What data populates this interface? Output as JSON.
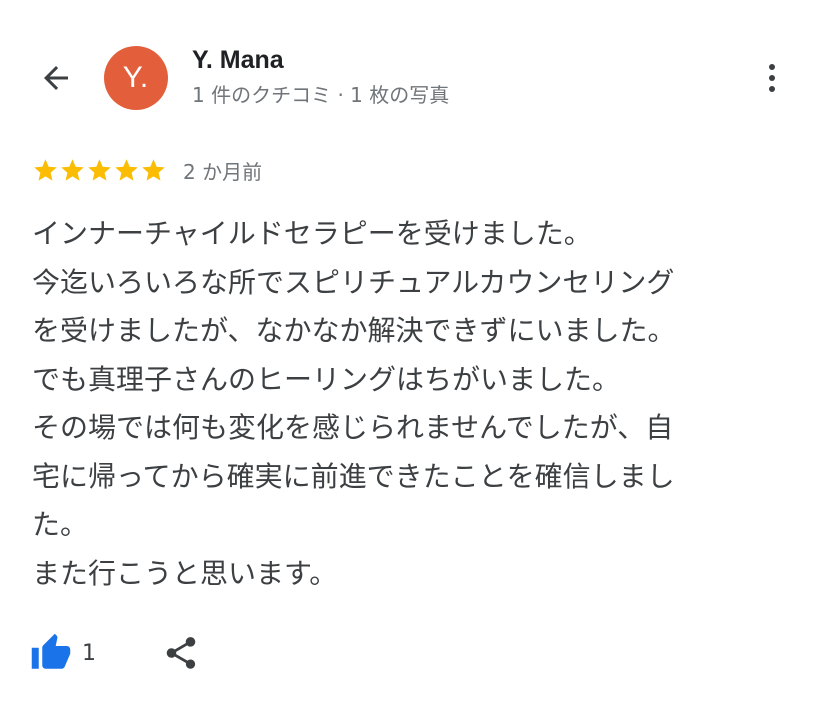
{
  "header": {
    "back_icon": "arrow-left-icon",
    "avatar_initial": "Y.",
    "avatar_color": "#e35f3b",
    "reviewer_name": "Y. Mana",
    "reviewer_meta": "1 件のクチコミ · 1 枚の写真",
    "more_icon": "more-vert-icon"
  },
  "review": {
    "rating": 5,
    "rating_max": 5,
    "star_color": "#fbbc04",
    "date": "2 か月前",
    "lines": [
      "インナーチャイルドセラピーを受けました。",
      "今迄いろいろな所でスピリチュアルカウンセリング",
      "を受けましたが、なかなか解決できずにいました。",
      "でも真理子さんのヒーリングはちがいました。",
      "その場では何も変化を感じられませんでしたが、自",
      "宅に帰ってから確実に前進できたことを確信しまし",
      "た。",
      "また行こうと思います。"
    ]
  },
  "actions": {
    "like_icon": "thumbs-up-icon",
    "like_color": "#1a73e8",
    "like_count": "1",
    "share_icon": "share-icon"
  }
}
